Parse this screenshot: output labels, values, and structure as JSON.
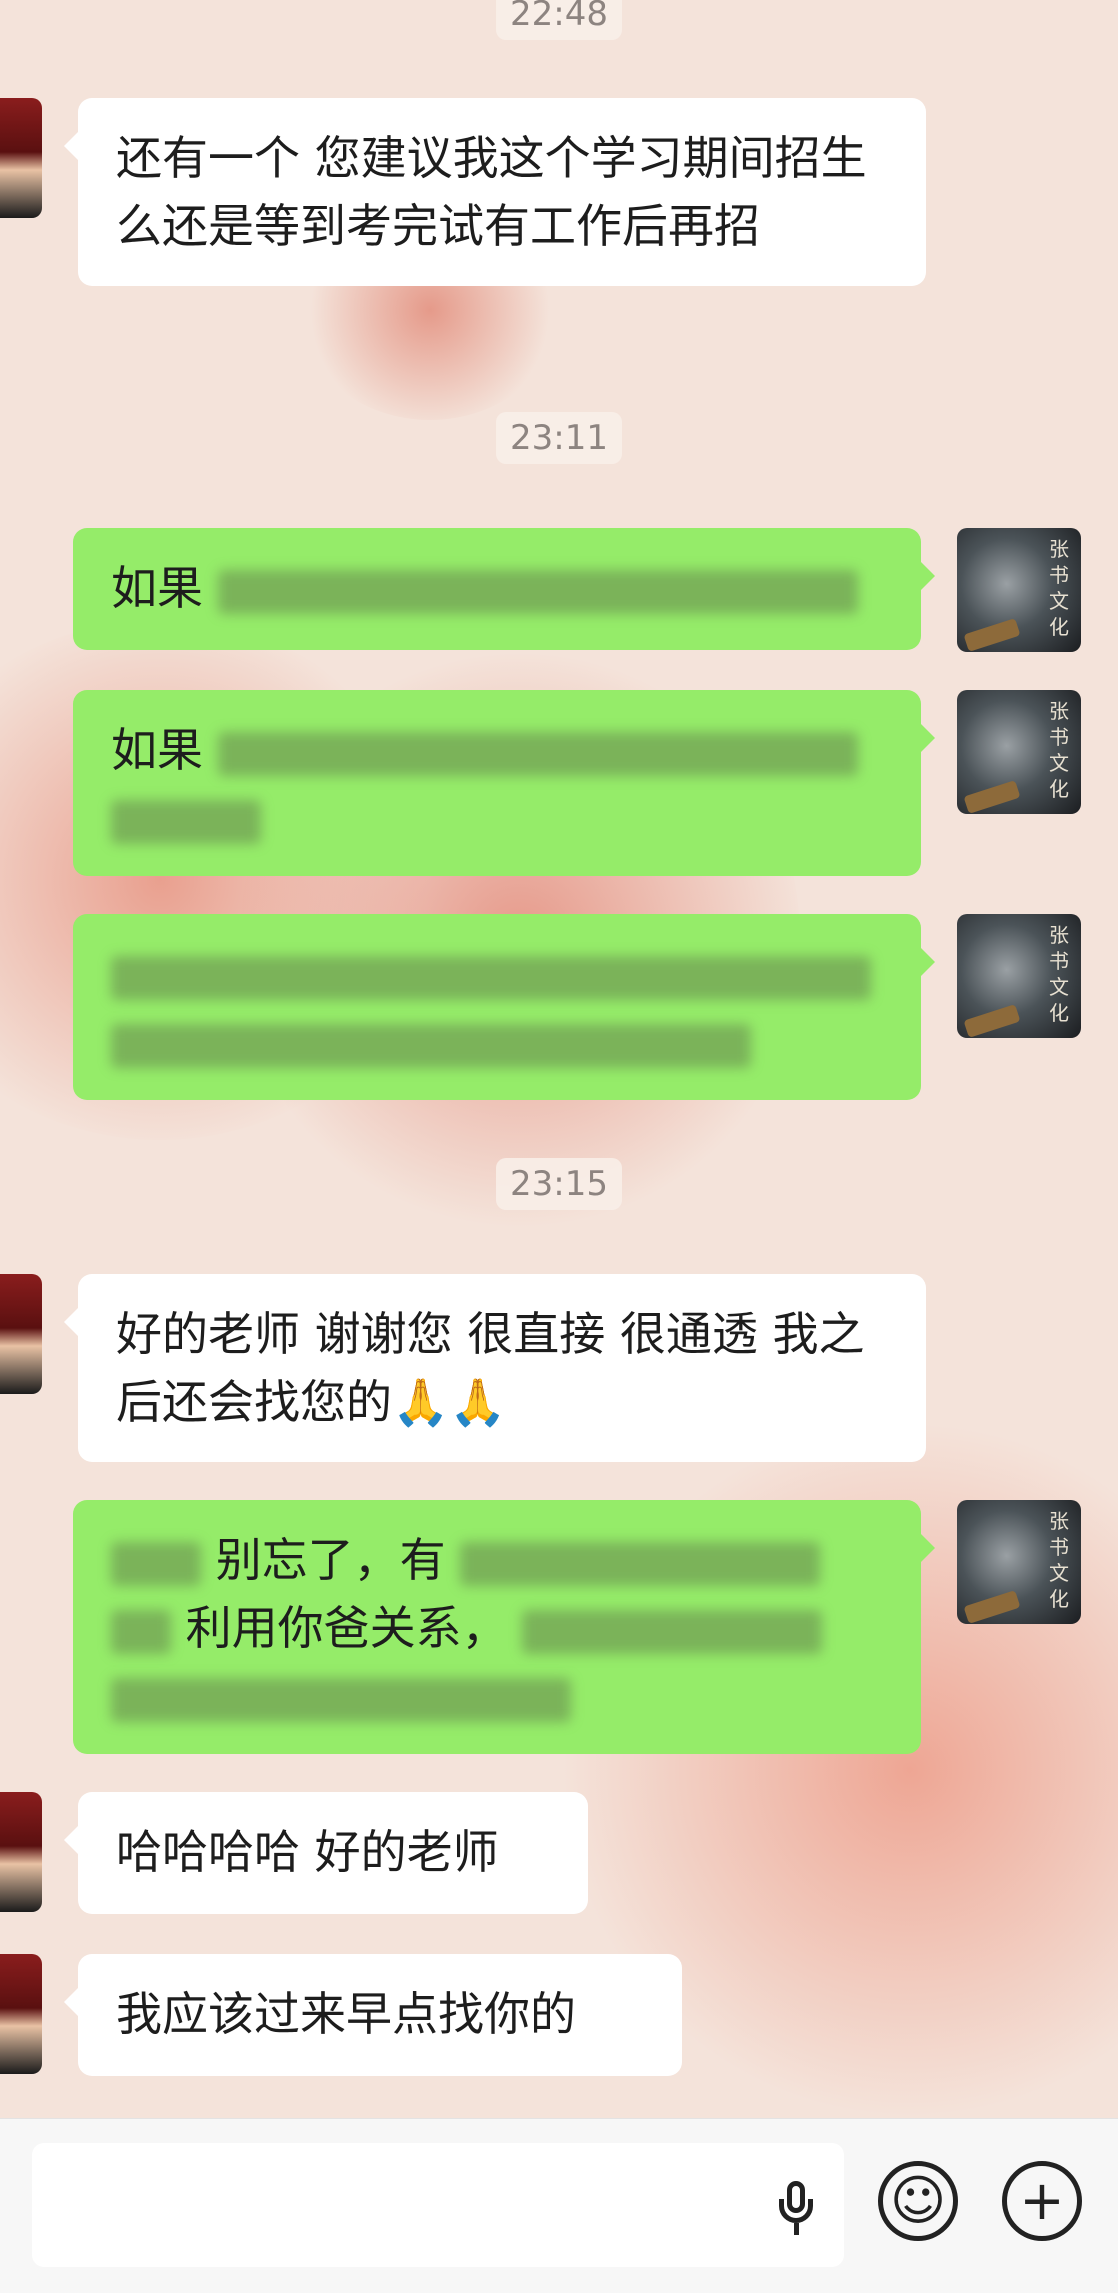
{
  "chat": {
    "timestamps": [
      "22:48",
      "23:11",
      "23:15"
    ],
    "messages": [
      {
        "side": "left",
        "text": "还有一个 您建议我这个学习期间招生么还是等到考完试有工作后再招"
      },
      {
        "side": "right",
        "visible": "如果"
      },
      {
        "side": "right",
        "visible": "如果"
      },
      {
        "side": "right",
        "visible": ""
      },
      {
        "side": "left",
        "text": "好的老师 谢谢您 很直接 很通透 我之后还会找您的🙏🙏"
      },
      {
        "side": "right",
        "visible_a": "别忘了，有",
        "visible_b": "利用你爸关系，"
      },
      {
        "side": "left",
        "text": "哈哈哈哈 好的老师"
      },
      {
        "side": "left",
        "text": "我应该过来早点找你的"
      }
    ],
    "contact_avatar_text": "张书文化"
  },
  "input_bar": {
    "mic_icon": "microphone-icon",
    "emoji_icon": "emoji-icon",
    "emoji_glyph": "☺",
    "plus_icon": "plus-icon",
    "plus_glyph": "+"
  }
}
